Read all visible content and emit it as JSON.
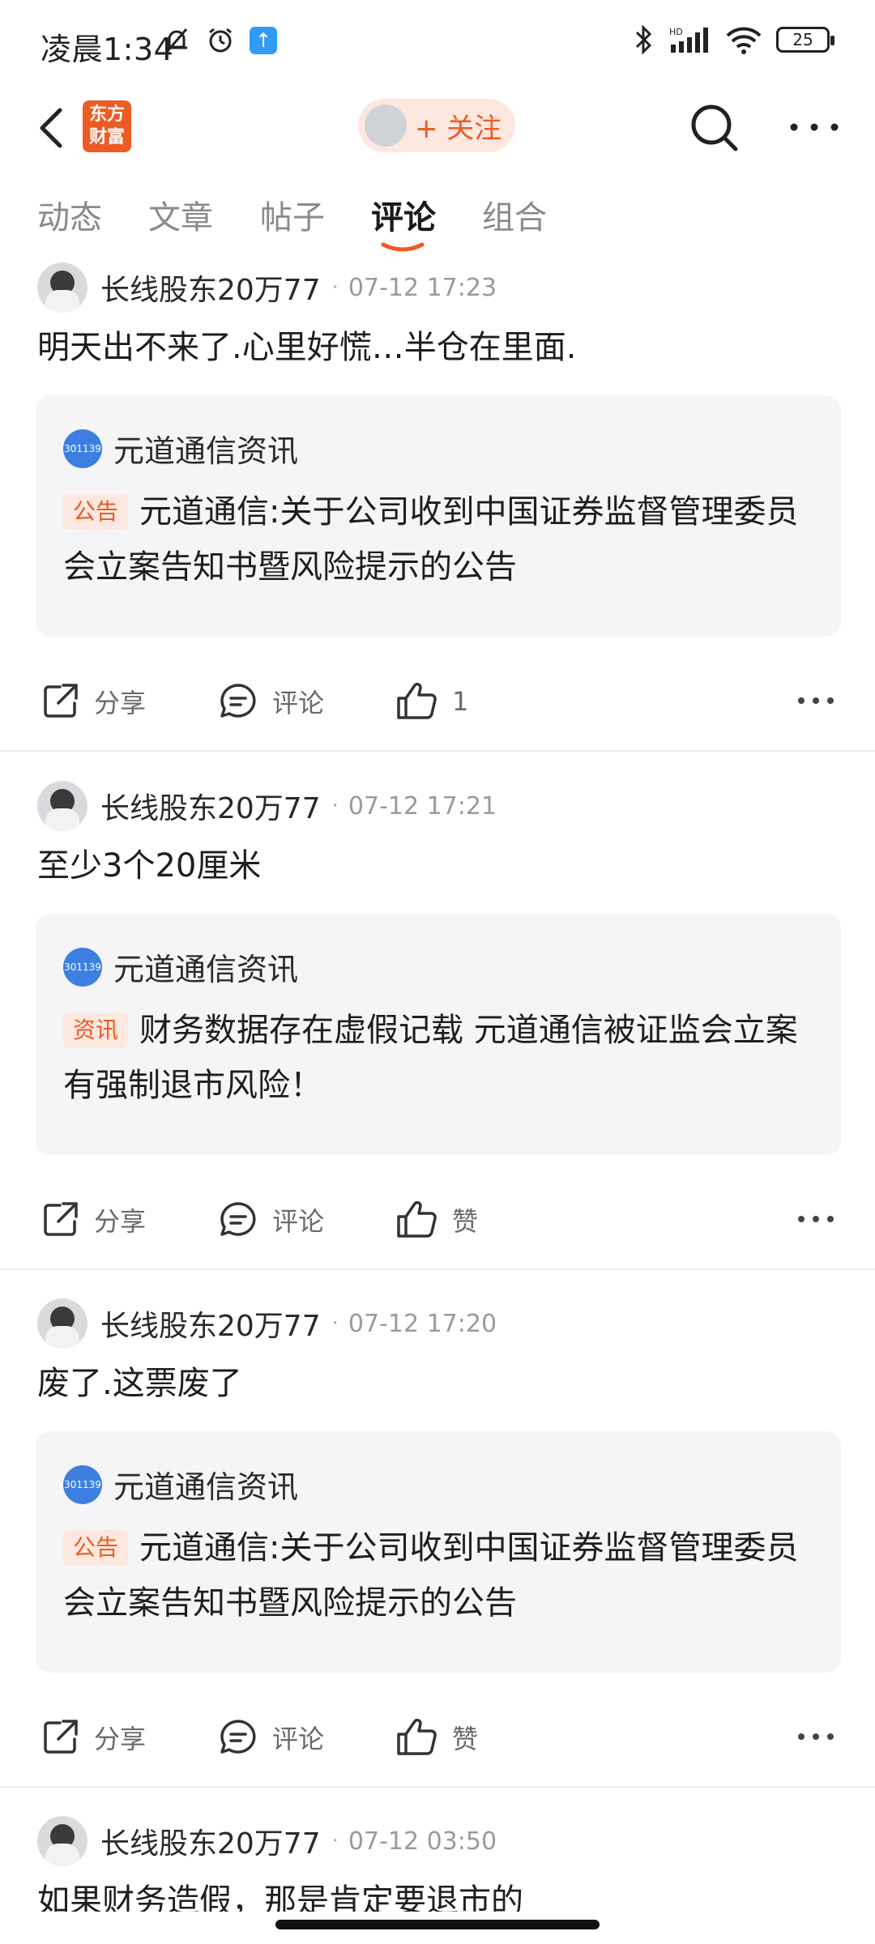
{
  "status_bar": {
    "time": "凌晨1:34",
    "upload_badge": "↑",
    "battery": "25"
  },
  "top_bar": {
    "logo_line1": "东方",
    "logo_line2": "财富",
    "follow_label": "+ 关注"
  },
  "tabs": [
    {
      "label": "动态",
      "active": false
    },
    {
      "label": "文章",
      "active": false
    },
    {
      "label": "帖子",
      "active": false
    },
    {
      "label": "评论",
      "active": true
    },
    {
      "label": "组合",
      "active": false
    }
  ],
  "colors": {
    "accent": "#ee5a24",
    "tag_bg": "#fde8e0",
    "card_bg": "#f5f5f7",
    "stock_badge": "#3d7fe0"
  },
  "posts": [
    {
      "username": "长线股东20万77",
      "separator": "·",
      "time": "07-12 17:23",
      "text": "明天出不来了.心里好慌…半仓在里面.",
      "card": {
        "stock_code": "301139",
        "source": "元道通信资讯",
        "tag": "公告",
        "title": "元道通信:关于公司收到中国证券监督管理委员会立案告知书暨风险提示的公告"
      },
      "actions": {
        "share": "分享",
        "comment": "评论",
        "like": "1"
      }
    },
    {
      "username": "长线股东20万77",
      "separator": "·",
      "time": "07-12 17:21",
      "text": "至少3个20厘米",
      "card": {
        "stock_code": "301139",
        "source": "元道通信资讯",
        "tag": "资讯",
        "title": "财务数据存在虚假记载 元道通信被证监会立案 有强制退市风险！"
      },
      "actions": {
        "share": "分享",
        "comment": "评论",
        "like": "赞"
      }
    },
    {
      "username": "长线股东20万77",
      "separator": "·",
      "time": "07-12 17:20",
      "text": "废了.这票废了",
      "card": {
        "stock_code": "301139",
        "source": "元道通信资讯",
        "tag": "公告",
        "title": "元道通信:关于公司收到中国证券监督管理委员会立案告知书暨风险提示的公告"
      },
      "actions": {
        "share": "分享",
        "comment": "评论",
        "like": "赞"
      }
    },
    {
      "username": "长线股东20万77",
      "separator": "·",
      "time": "07-12 03:50",
      "text": "如果财务造假，那是肯定要退市的"
    }
  ]
}
